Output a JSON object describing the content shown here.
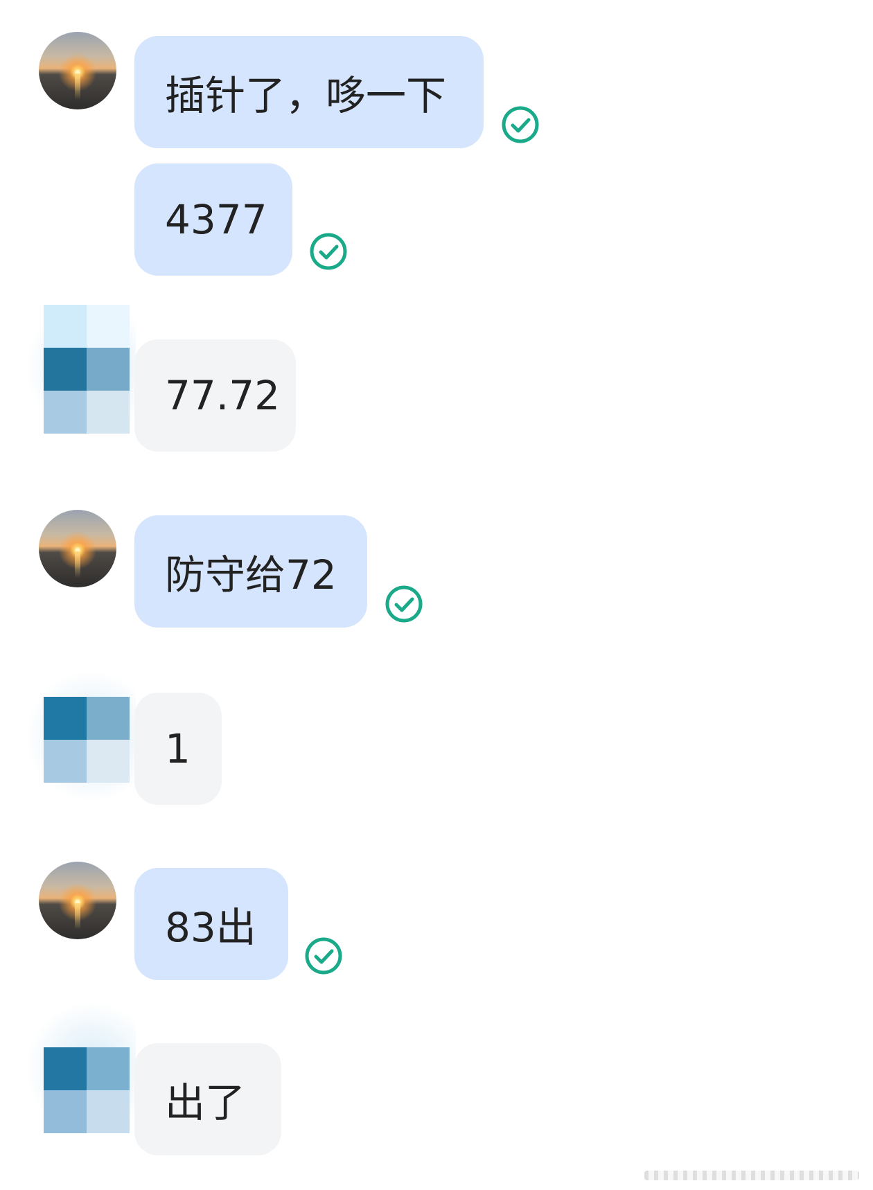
{
  "messages": [
    {
      "sender": "self",
      "text": "插针了，哆一下",
      "read": true
    },
    {
      "sender": "self",
      "text": "4377",
      "read": true
    },
    {
      "sender": "other",
      "text": "77.72"
    },
    {
      "sender": "self",
      "text": "防守给72",
      "read": true
    },
    {
      "sender": "other",
      "text": "1"
    },
    {
      "sender": "self",
      "text": "83出",
      "read": true
    },
    {
      "sender": "other",
      "text": "出了"
    }
  ],
  "colors": {
    "self_bubble": "#d5e5fe",
    "other_bubble": "#f3f4f6",
    "read_check": "#1aaa8a",
    "mosaic": [
      "#d0ecfb",
      "#e9f6fd",
      "#23759e",
      "#77aac9",
      "#a8cbe3",
      "#d5e6f1"
    ]
  },
  "icons": {
    "read_receipt": "check-circle-icon",
    "self_avatar": "sunset-avatar",
    "other_avatar": "mosaic-avatar"
  }
}
